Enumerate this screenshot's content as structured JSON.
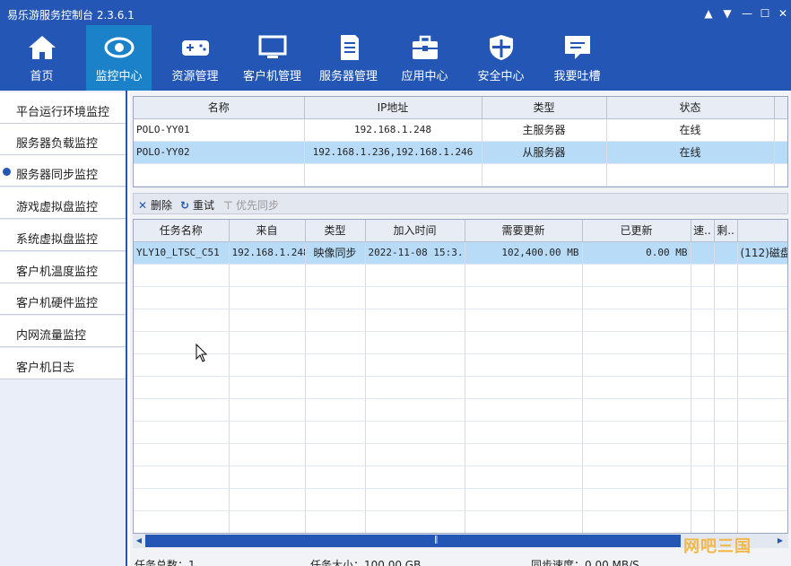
{
  "app": {
    "title": "易乐游服务控制台 2.3.6.1"
  },
  "nav": [
    {
      "label": "首页",
      "icon": "home-icon"
    },
    {
      "label": "监控中心",
      "icon": "eye-icon"
    },
    {
      "label": "资源管理",
      "icon": "gamepad-icon"
    },
    {
      "label": "客户机管理",
      "icon": "monitor-icon"
    },
    {
      "label": "服务器管理",
      "icon": "server-icon"
    },
    {
      "label": "应用中心",
      "icon": "toolbox-icon"
    },
    {
      "label": "安全中心",
      "icon": "shield-icon"
    },
    {
      "label": "我要吐槽",
      "icon": "message-icon"
    }
  ],
  "sidebar": [
    {
      "label": "平台运行环境监控"
    },
    {
      "label": "服务器负载监控"
    },
    {
      "label": "服务器同步监控"
    },
    {
      "label": "游戏虚拟盘监控"
    },
    {
      "label": "系统虚拟盘监控"
    },
    {
      "label": "客户机温度监控"
    },
    {
      "label": "客户机硬件监控"
    },
    {
      "label": "内网流量监控"
    },
    {
      "label": "客户机日志"
    }
  ],
  "servers": {
    "headers": [
      "名称",
      "IP地址",
      "类型",
      "状态"
    ],
    "rows": [
      [
        "POLO-YY01",
        "192.168.1.248",
        "主服务器",
        "在线"
      ],
      [
        "POLO-YY02",
        "192.168.1.236,192.168.1.246",
        "从服务器",
        "在线"
      ]
    ]
  },
  "toolbar": {
    "delete": "删除",
    "retry": "重试",
    "priority": "优先同步"
  },
  "tasks": {
    "headers": [
      "任务名称",
      "来自",
      "类型",
      "加入时间",
      "需要更新",
      "已更新",
      "速..",
      "剩..",
      ""
    ],
    "rows": [
      [
        "YLY10_LTSC_C51",
        "192.168.1.248",
        "映像同步",
        "2022-11-08 15:3...",
        "102,400.00 MB",
        "0.00 MB",
        "",
        "",
        "(112)磁盘"
      ]
    ]
  },
  "status": {
    "total": "任务总数：1",
    "size": "任务大小：100.00 GB",
    "speed": "同步速度：0.00 MB/S"
  },
  "watermark": "网吧三国"
}
